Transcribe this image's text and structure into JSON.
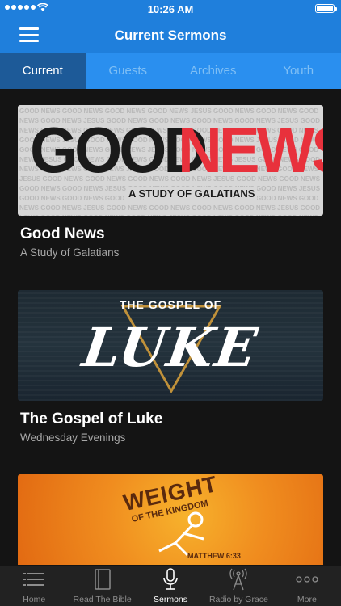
{
  "status_bar": {
    "time": "10:26 AM"
  },
  "header": {
    "title": "Current Sermons"
  },
  "tabs": [
    {
      "label": "Current",
      "active": true
    },
    {
      "label": "Guests",
      "active": false
    },
    {
      "label": "Archives",
      "active": false
    },
    {
      "label": "Youth",
      "active": false
    }
  ],
  "sermons": [
    {
      "title": "Good News",
      "subtitle": "A Study of Galatians",
      "artwork": {
        "word1": "GOOD",
        "word2": "NEWS",
        "caption": "A STUDY OF GALATIANS",
        "pattern_text": "GOOD NEWS GOOD NEWS GOOD NEWS GOOD NEWS JESUS"
      }
    },
    {
      "title": "The Gospel of Luke",
      "subtitle": "Wednesday Evenings",
      "artwork": {
        "top": "THE GOSPEL OF",
        "big": "LUKE"
      }
    },
    {
      "title": "",
      "subtitle": "",
      "artwork": {
        "word1": "WEIGHT",
        "word2": "OF THE KINGDOM",
        "verse": "MATTHEW 6:33"
      }
    }
  ],
  "tabbar": [
    {
      "label": "Home",
      "icon": "list-icon",
      "active": false
    },
    {
      "label": "Read The Bible",
      "icon": "book-icon",
      "active": false
    },
    {
      "label": "Sermons",
      "icon": "microphone-icon",
      "active": true
    },
    {
      "label": "Radio by Grace",
      "icon": "radio-tower-icon",
      "active": false
    },
    {
      "label": "More",
      "icon": "more-icon",
      "active": false
    }
  ],
  "colors": {
    "header_blue": "#1f7fdc",
    "tabs_blue": "#2a8fef",
    "active_tab": "#1d5a98",
    "background": "#141414",
    "news_red": "#e8313c"
  }
}
